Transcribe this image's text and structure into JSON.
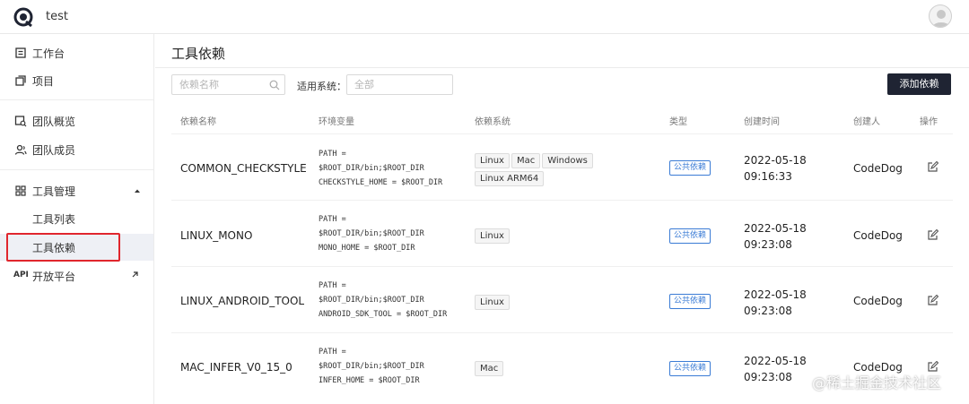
{
  "app": {
    "title": "test"
  },
  "sidebar": {
    "items": [
      {
        "label": "工作台"
      },
      {
        "label": "项目"
      },
      {
        "label": "团队概览"
      },
      {
        "label": "团队成员"
      },
      {
        "label": "工具管理"
      },
      {
        "label": "工具列表"
      },
      {
        "label": "工具依赖"
      },
      {
        "label": "开放平台",
        "tag": "API"
      }
    ]
  },
  "page": {
    "title": "工具依赖"
  },
  "filters": {
    "search_placeholder": "依赖名称",
    "system_label": "适用系统：",
    "system_placeholder": "全部"
  },
  "actions": {
    "add_label": "添加依赖"
  },
  "table": {
    "columns": [
      "依赖名称",
      "环境变量",
      "依赖系统",
      "类型",
      "创建时间",
      "创建人",
      "操作"
    ],
    "rows": [
      {
        "name": "COMMON_CHECKSTYLE",
        "env": [
          "PATH =",
          "$ROOT_DIR/bin;$ROOT_DIR",
          "CHECKSTYLE_HOME = $ROOT_DIR"
        ],
        "systems": [
          "Linux",
          "Mac",
          "Windows",
          "Linux ARM64"
        ],
        "type": "公共依赖",
        "date": "2022-05-18",
        "time": "09:16:33",
        "creator": "CodeDog"
      },
      {
        "name": "LINUX_MONO",
        "env": [
          "PATH =",
          "$ROOT_DIR/bin;$ROOT_DIR",
          "MONO_HOME = $ROOT_DIR"
        ],
        "systems": [
          "Linux"
        ],
        "type": "公共依赖",
        "date": "2022-05-18",
        "time": "09:23:08",
        "creator": "CodeDog"
      },
      {
        "name": "LINUX_ANDROID_TOOL",
        "env": [
          "PATH =",
          "$ROOT_DIR/bin;$ROOT_DIR",
          "ANDROID_SDK_TOOL = $ROOT_DIR"
        ],
        "systems": [
          "Linux"
        ],
        "type": "公共依赖",
        "date": "2022-05-18",
        "time": "09:23:08",
        "creator": "CodeDog"
      },
      {
        "name": "MAC_INFER_V0_15_0",
        "env": [
          "PATH =",
          "$ROOT_DIR/bin;$ROOT_DIR",
          "INFER_HOME = $ROOT_DIR"
        ],
        "systems": [
          "Mac"
        ],
        "type": "公共依赖",
        "date": "2022-05-18",
        "time": "09:23:08",
        "creator": "CodeDog"
      }
    ]
  },
  "watermark": "@稀土掘金技术社区",
  "colors": {
    "primary_button": "#1f2433",
    "type_tag": "#3a7bd5",
    "highlight_box": "#e0262d"
  }
}
